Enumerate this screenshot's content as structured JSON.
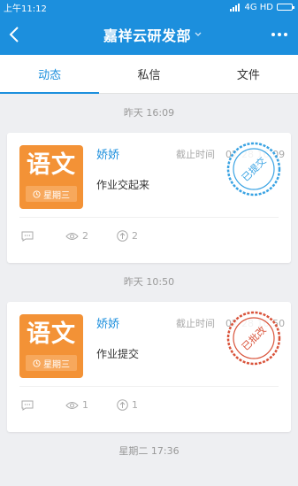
{
  "status_bar": {
    "time": "上午11:12",
    "network": "4G HD"
  },
  "header": {
    "title": "嘉祥云研发部"
  },
  "tabs": [
    {
      "label": "动态",
      "active": true
    },
    {
      "label": "私信",
      "active": false
    },
    {
      "label": "文件",
      "active": false
    }
  ],
  "feed": [
    {
      "date": "昨天  16:09",
      "subject": "语文",
      "day": "星期三",
      "author": "娇娇",
      "deadline_label": "截止时间",
      "deadline_value": "02-28 16:09",
      "content": "作业交起来",
      "stamp": "已提交",
      "stamp_color": "#3aa3e3",
      "views": "2",
      "likes": "2"
    },
    {
      "date": "昨天  10:50",
      "subject": "语文",
      "day": "星期三",
      "author": "娇娇",
      "deadline_label": "截止时间",
      "deadline_value": "02-28 10:50",
      "content": "作业提交",
      "stamp": "已批改",
      "stamp_color": "#d9533a",
      "views": "1",
      "likes": "1"
    }
  ],
  "next_date": "星期二  17:36",
  "colors": {
    "primary": "#1c8fdd",
    "subject_badge": "#f39236"
  }
}
